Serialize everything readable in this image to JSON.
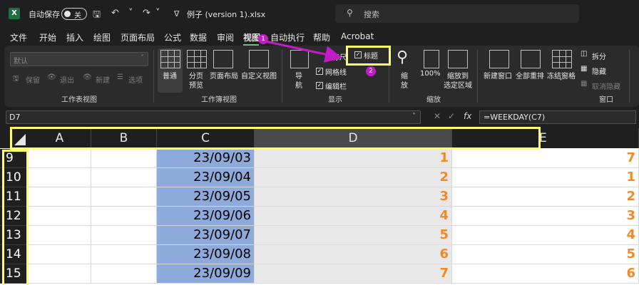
{
  "titlebar": {
    "app_icon": "X",
    "autosave_label": "自动保存",
    "toggle_state": "关",
    "filename": "例子 (version 1).xlsx",
    "search_placeholder": "搜索",
    "icons": [
      "save-icon",
      "undo-icon",
      "redo-icon",
      "customize-icon"
    ]
  },
  "tabs": [
    "文件",
    "开始",
    "插入",
    "绘图",
    "页面布局",
    "公式",
    "数据",
    "审阅",
    "视图",
    "自动执行",
    "帮助",
    "Acrobat"
  ],
  "active_tab": "视图",
  "ribbon": {
    "sheet_view": {
      "dropdown_value": "默认",
      "keep": "保留",
      "exit": "退出",
      "new": "新建",
      "options": "选项",
      "label": "工作表视图"
    },
    "workbook_views": {
      "normal": "普通",
      "page_break_1": "分页",
      "page_break_2": "预览",
      "page_layout": "页面布局",
      "custom_views": "自定义视图",
      "label": "工作簿视图"
    },
    "show": {
      "nav_1": "导",
      "nav_2": "航",
      "ruler": "标尺",
      "gridlines": "网格线",
      "formula_bar": "编辑栏",
      "headings": "标题",
      "label": "显示"
    },
    "zoom": {
      "zoom_1": "缩",
      "zoom_2": "放",
      "percent": "100%",
      "to_sel_1": "缩放到",
      "to_sel_2": "选定区域",
      "label": "缩放"
    },
    "window": {
      "new_window": "新建窗口",
      "arrange_all": "全部重排",
      "freeze": "冻结窗格",
      "split": "拆分",
      "hide": "隐藏",
      "unhide": "取消隐藏",
      "label": "窗口"
    }
  },
  "badges": [
    "1",
    "2"
  ],
  "formula_bar": {
    "name_box": "D7",
    "formula": "=WEEKDAY(C7)",
    "fx": "fx"
  },
  "sheet": {
    "columns": [
      "A",
      "B",
      "C",
      "D",
      "E"
    ],
    "rows": [
      {
        "num": "9",
        "c": "23/09/03",
        "d": "1",
        "e": "7"
      },
      {
        "num": "10",
        "c": "23/09/04",
        "d": "2",
        "e": "1"
      },
      {
        "num": "11",
        "c": "23/09/05",
        "d": "3",
        "e": "2"
      },
      {
        "num": "12",
        "c": "23/09/06",
        "d": "4",
        "e": "3"
      },
      {
        "num": "13",
        "c": "23/09/07",
        "d": "5",
        "e": "4"
      },
      {
        "num": "14",
        "c": "23/09/08",
        "d": "6",
        "e": "5"
      },
      {
        "num": "15",
        "c": "23/09/09",
        "d": "7",
        "e": "6"
      }
    ]
  },
  "colors": {
    "highlight": "#ffff66",
    "badge": "#c21cc4",
    "column_c_fill": "#8eaadb",
    "number_orange": "#f08a28"
  }
}
